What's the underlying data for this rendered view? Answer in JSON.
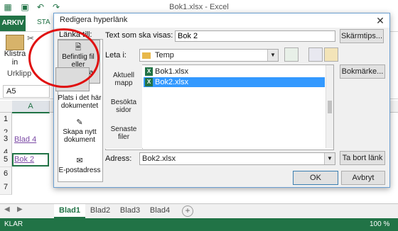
{
  "excel": {
    "window_title": "Bok1.xlsx - Excel",
    "tabs": {
      "file": "ARKIV",
      "home": "STA"
    },
    "ribbon": {
      "paste": "Klistra",
      "paste_sub": "in",
      "group": "Urklipp"
    },
    "namebox": "A5",
    "column_a": "A",
    "rows": [
      {
        "num": "1",
        "text": ""
      },
      {
        "num": "2",
        "text": ""
      },
      {
        "num": "3",
        "text": "Blad 4"
      },
      {
        "num": "4",
        "text": ""
      },
      {
        "num": "5",
        "text": "Bok 2"
      },
      {
        "num": "6",
        "text": ""
      },
      {
        "num": "7",
        "text": ""
      }
    ],
    "sheets": [
      "Blad1",
      "Blad2",
      "Blad3",
      "Blad4"
    ],
    "active_sheet": "Blad1",
    "status": "KLAR",
    "zoom": "100 %",
    "colors": {
      "accent": "#217346",
      "link": "#7b4aa5"
    }
  },
  "dialog": {
    "title": "Redigera hyperlänk",
    "close": "✕",
    "link_to_label": "Länka till:",
    "link_to_items": [
      {
        "label": "Befintlig fil eller webbsida",
        "icon": "document-globe-icon"
      },
      {
        "label": "Plats i det här dokumentet",
        "icon": "document-place-icon"
      },
      {
        "label": "Skapa nytt dokument",
        "icon": "new-document-icon"
      },
      {
        "label": "E-postadress",
        "icon": "email-icon"
      }
    ],
    "text_to_display_label": "Text som ska visas:",
    "text_to_display_value": "Bok 2",
    "screentip_button": "Skärmtips...",
    "look_in_label": "Leta i:",
    "look_in_value": "Temp",
    "places": [
      "Aktuell mapp",
      "Besökta sidor",
      "Senaste filer"
    ],
    "files": [
      "Bok1.xlsx",
      "Bok2.xlsx"
    ],
    "selected_file": "Bok2.xlsx",
    "bookmark_button": "Bokmärke...",
    "address_label": "Adress:",
    "address_value": "Bok2.xlsx",
    "remove_link_button": "Ta bort länk",
    "ok_button": "OK",
    "cancel_button": "Avbryt"
  }
}
